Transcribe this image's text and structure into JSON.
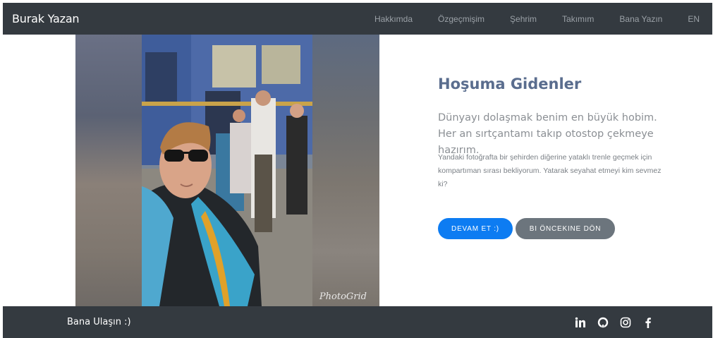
{
  "navbar": {
    "brand": "Burak Yazan",
    "links": [
      "Hakkımda",
      "Özgeçmişim",
      "Şehrim",
      "Takımım",
      "Bana Yazın",
      "EN"
    ]
  },
  "photo": {
    "watermark": "PhotoGrid"
  },
  "main": {
    "heading": "Hoşuma Gidenler",
    "lead": "Dünyayı dolaşmak benim en büyük hobim. Her an sırtçantamı takıp otostop çekmeye hazırım.",
    "description": "Yandaki fotoğrafta bir şehirden diğerine yataklı trenle geçmek için kompartıman sırası bekliyorum. Yatarak seyahat etmeyi kim sevmez ki?",
    "primary_button": "DEVAM ET :)",
    "secondary_button": "BI ÖNCEKINE DÖN"
  },
  "footer": {
    "text": "Bana Ulaşın :)",
    "social_icons": [
      "linkedin-icon",
      "github-icon",
      "instagram-icon",
      "facebook-icon"
    ]
  },
  "colors": {
    "navbar_bg": "#343a40",
    "heading": "#5a6d8e",
    "primary": "#0d7cf2",
    "secondary": "#6c757d"
  }
}
